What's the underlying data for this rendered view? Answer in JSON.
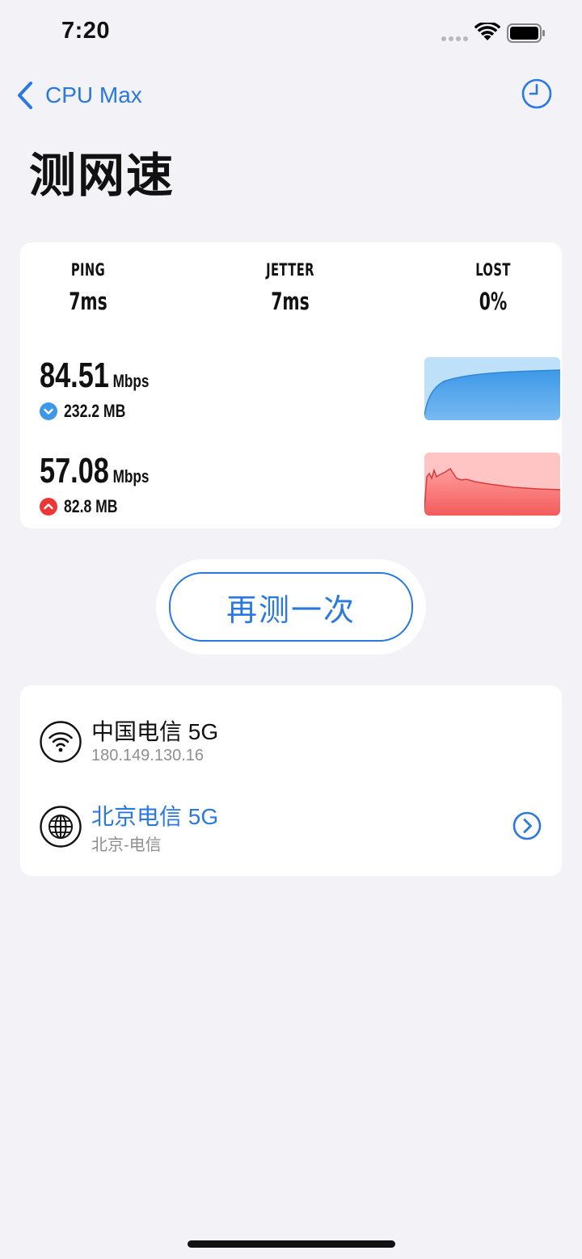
{
  "status_bar": {
    "time": "7:20"
  },
  "nav": {
    "back_label": "CPU Max",
    "history_icon": "clock-icon"
  },
  "page": {
    "title": "测网速"
  },
  "metrics": {
    "ping": {
      "label": "PING",
      "value": "7ms"
    },
    "jetter": {
      "label": "JETTER",
      "value": "7ms"
    },
    "lost": {
      "label": "LOST",
      "value": "0%"
    }
  },
  "download": {
    "speed": "84.51",
    "unit": "Mbps",
    "amount": "232.2 MB",
    "icon": "chevron-down-circle-icon",
    "color": "#3d99e8"
  },
  "upload": {
    "speed": "57.08",
    "unit": "Mbps",
    "amount": "82.8 MB",
    "icon": "chevron-up-circle-icon",
    "color": "#f04a4a"
  },
  "retest": {
    "label": "再测一次"
  },
  "network": {
    "local": {
      "name": "中国电信 5G",
      "ip": "180.149.130.16",
      "icon": "wifi-icon"
    },
    "server": {
      "name": "北京电信 5G",
      "location": "北京-电信",
      "icon": "globe-icon",
      "color": "#2a79e0"
    }
  },
  "colors": {
    "accent": "#2a79e0",
    "background": "#f2f2f7"
  }
}
